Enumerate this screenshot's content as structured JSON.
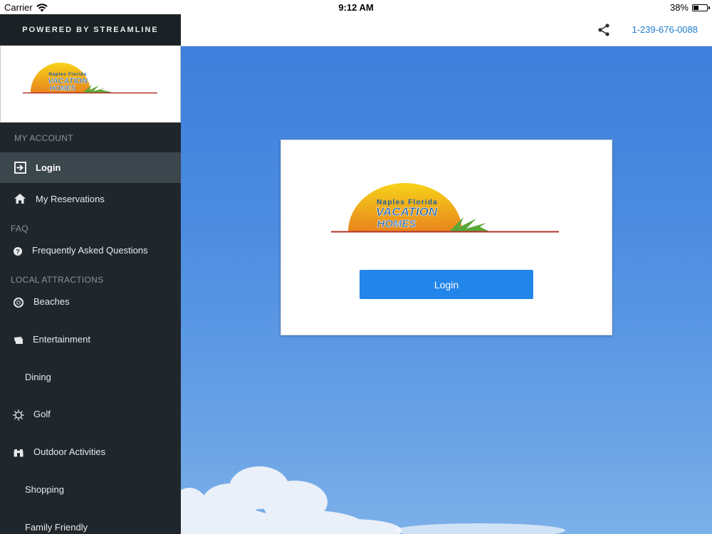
{
  "status_bar": {
    "carrier": "Carrier",
    "time": "9:12 AM",
    "battery_percent_label": "38%",
    "battery_level": 0.38
  },
  "sidebar": {
    "powered_by": "POWERED BY STREAMLINE",
    "logo": {
      "line1": "Naples Florida",
      "line2": "VACATION",
      "line3": "HOMES"
    },
    "sections": [
      {
        "heading": "MY ACCOUNT",
        "items": [
          {
            "label": "Login",
            "icon": "login-icon",
            "active": true
          },
          {
            "label": "My Reservations",
            "icon": "home-icon"
          }
        ]
      },
      {
        "heading": "FAQ",
        "items": [
          {
            "label": "Frequently Asked Questions",
            "icon": "question-circle-icon"
          }
        ]
      },
      {
        "heading": "LOCAL ATTRACTIONS",
        "items": [
          {
            "label": "Beaches",
            "icon": "life-ring-icon"
          },
          {
            "label": "Entertainment",
            "icon": "ticket-icon"
          },
          {
            "label": "Dining",
            "icon": ""
          },
          {
            "label": "Golf",
            "icon": "sun-icon"
          },
          {
            "label": "Outdoor Activities",
            "icon": "binoculars-icon"
          },
          {
            "label": "Shopping",
            "icon": ""
          },
          {
            "label": "Family Friendly",
            "icon": ""
          }
        ]
      }
    ]
  },
  "topbar": {
    "share_icon": "share-icon",
    "phone": "1-239-676-0088"
  },
  "card": {
    "logo": {
      "line1": "Naples Florida",
      "line2": "VACATION",
      "line3": "HOMES"
    },
    "login_label": "Login"
  },
  "colors": {
    "sidebar_bg": "#20272c",
    "active_item_bg": "#3b464d",
    "accent_blue": "#2285ea",
    "phone_link": "#1f7bd3",
    "logo_text": "#1b5fa8",
    "sun_yellow": "#f5c400",
    "sun_orange": "#e98a1a",
    "horizon_red": "#b5322b"
  }
}
